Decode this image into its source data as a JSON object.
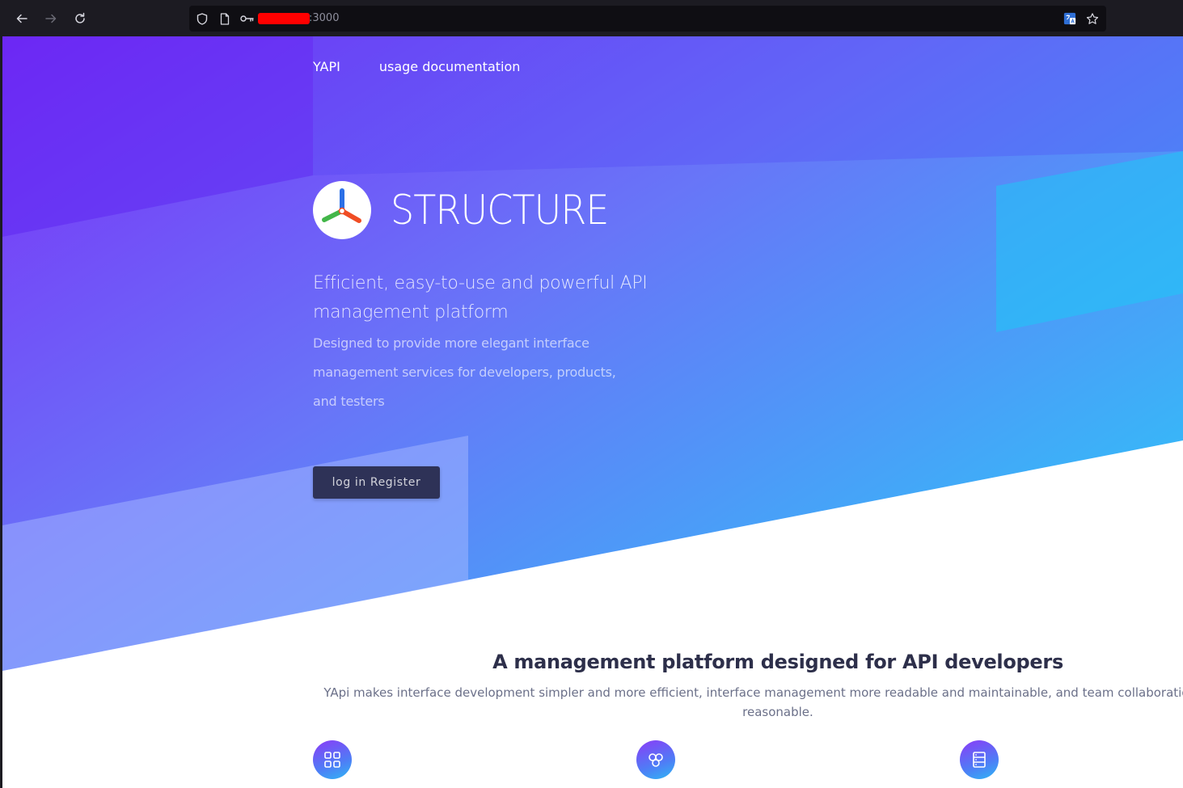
{
  "browser": {
    "url_suffix": ":3000",
    "icons": [
      "back-arrow-icon",
      "forward-arrow-icon",
      "reload-icon",
      "shield-icon",
      "page-icon",
      "key-icon",
      "translate-icon",
      "bookmark-star-icon"
    ]
  },
  "nav": {
    "brand_link": "YAPI",
    "docs_link": "usage documentation"
  },
  "hero": {
    "title": "STRUCTURE",
    "tagline": "Efficient, easy-to-use and powerful API management platform",
    "description": "Designed to provide more elegant interface management services for developers, products, and testers",
    "login_button": "log in Register"
  },
  "section": {
    "title": "A management platform designed for API developers",
    "subtitle": "YApi makes interface development simpler and more efficient, interface management more readable and maintainable, and team collaboration more reasonable."
  },
  "features": [
    {
      "icon": "grid-icon"
    },
    {
      "icon": "cubes-icon"
    },
    {
      "icon": "server-icon"
    }
  ],
  "colors": {
    "hero_start": "#7b2ff7",
    "hero_end": "#2fc0f8",
    "button_bg": "#2e3257",
    "section_title": "#2d2f4a"
  }
}
